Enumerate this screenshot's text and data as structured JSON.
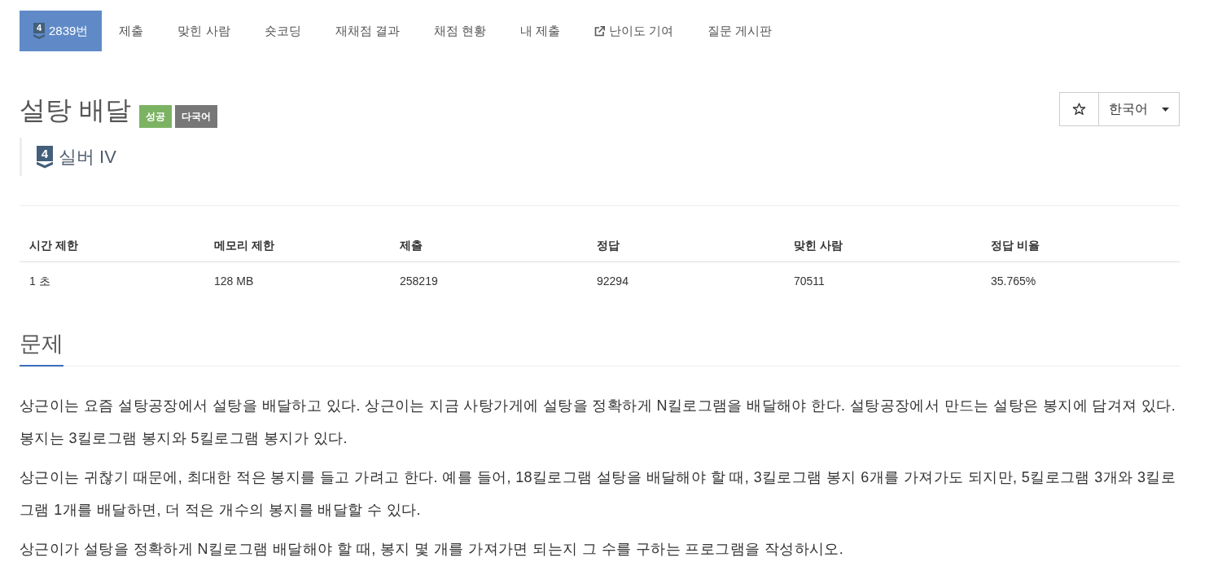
{
  "nav": {
    "tabs": [
      {
        "kind": "problem",
        "badge": "4",
        "label": "2839번",
        "selected": true
      },
      {
        "kind": "plain",
        "label": "제출",
        "selected": false
      },
      {
        "kind": "plain",
        "label": "맞힌 사람",
        "selected": false
      },
      {
        "kind": "plain",
        "label": "숏코딩",
        "selected": false
      },
      {
        "kind": "plain",
        "label": "재채점 결과",
        "selected": false
      },
      {
        "kind": "plain",
        "label": "채점 현황",
        "selected": false
      },
      {
        "kind": "plain",
        "label": "내 제출",
        "selected": false
      },
      {
        "kind": "external",
        "label": "난이도 기여",
        "selected": false
      },
      {
        "kind": "plain",
        "label": "질문 게시판",
        "selected": false
      }
    ]
  },
  "problem": {
    "title": "설탕 배달",
    "tags": [
      {
        "label": "성공",
        "color": "#7cb363"
      },
      {
        "label": "다국어",
        "color": "#777777"
      }
    ],
    "tier": {
      "badge": "4",
      "label": "실버 IV"
    },
    "favorite": {
      "starred": false
    },
    "language": {
      "value": "한국어"
    }
  },
  "limits": {
    "columns": [
      "시간 제한",
      "메모리 제한",
      "제출",
      "정답",
      "맞힌 사람",
      "정답 비율"
    ],
    "rows": [
      [
        "1 초",
        "128 MB",
        "258219",
        "92294",
        "70511",
        "35.765%"
      ]
    ]
  },
  "description": {
    "heading": "문제",
    "paragraphs": [
      "상근이는 요즘 설탕공장에서 설탕을 배달하고 있다. 상근이는 지금 사탕가게에 설탕을 정확하게 N킬로그램을 배달해야 한다. 설탕공장에서 만드는 설탕은 봉지에 담겨져 있다. 봉지는 3킬로그램 봉지와 5킬로그램 봉지가 있다.",
      "상근이는 귀찮기 때문에, 최대한 적은 봉지를 들고 가려고 한다. 예를 들어, 18킬로그램 설탕을 배달해야 할 때, 3킬로그램 봉지 6개를 가져가도 되지만, 5킬로그램 3개와 3킬로그램 1개를 배달하면, 더 적은 개수의 봉지를 배달할 수 있다.",
      "상근이가 설탕을 정확하게 N킬로그램 배달해야 할 때, 봉지 몇 개를 가져가면 되는지 그 수를 구하는 프로그램을 작성하시오."
    ]
  }
}
